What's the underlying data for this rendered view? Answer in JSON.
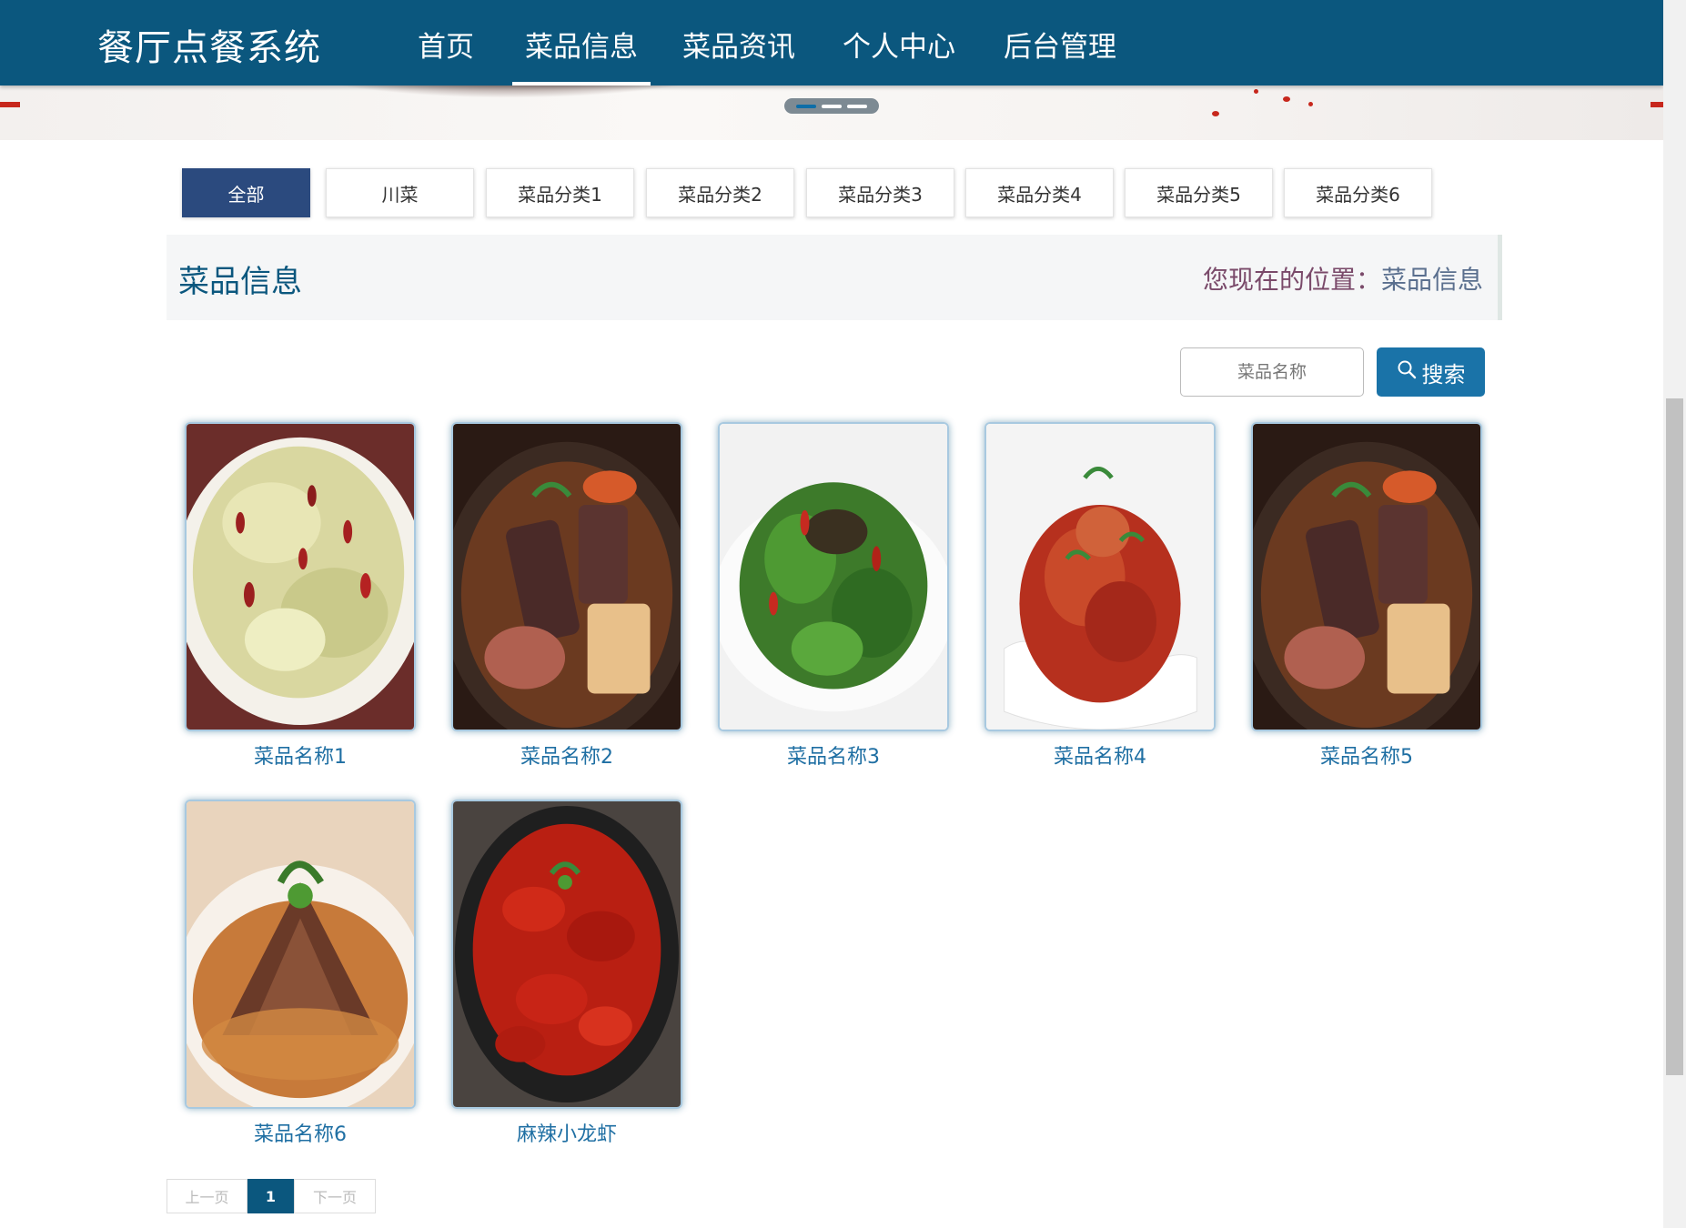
{
  "brand": "餐厅点餐系统",
  "nav": {
    "items": [
      "首页",
      "菜品信息",
      "菜品资讯",
      "个人中心",
      "后台管理"
    ],
    "active_index": 1
  },
  "categories": {
    "items": [
      "全部",
      "川菜",
      "菜品分类1",
      "菜品分类2",
      "菜品分类3",
      "菜品分类4",
      "菜品分类5",
      "菜品分类6"
    ],
    "active_index": 0
  },
  "title_bar": {
    "title": "菜品信息",
    "location_prefix": "您现在的位置：",
    "location_current": "菜品信息"
  },
  "search": {
    "placeholder": "菜品名称",
    "button_label": "搜索",
    "button_icon": "search-icon"
  },
  "products": [
    {
      "name": "菜品名称1",
      "image": "stir-fried-cabbage"
    },
    {
      "name": "菜品名称2",
      "image": "clay-pot-pork"
    },
    {
      "name": "菜品名称3",
      "image": "dry-fried-green-beans"
    },
    {
      "name": "菜品名称4",
      "image": "chili-chicken"
    },
    {
      "name": "菜品名称5",
      "image": "clay-pot-pork"
    },
    {
      "name": "菜品名称6",
      "image": "sliced-beef-sesame"
    },
    {
      "name": "麻辣小龙虾",
      "image": "spicy-crayfish"
    }
  ],
  "pagination": {
    "prev_label": "上一页",
    "current_page": "1",
    "next_label": "下一页"
  },
  "colors": {
    "navbar": "#0b577e",
    "active_tab": "#2b4a7e",
    "search_button": "#1a73a8",
    "product_name": "#1f6fa3"
  }
}
